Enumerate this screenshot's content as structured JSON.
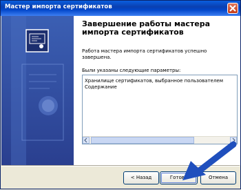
{
  "window": {
    "title": "Мастер импорта сертификатов"
  },
  "main": {
    "heading": "Завершение работы мастера импорта сертификатов",
    "description": "Работа мастера импорта сертификатов успешно завершена.",
    "params_label": "Были указаны следующие параметры:",
    "params": [
      "Хранилище сертификатов, выбранное пользователем",
      "Содержание"
    ]
  },
  "buttons": {
    "back": "< Назад",
    "finish": "Готово",
    "cancel": "Отмена"
  },
  "colors": {
    "titlebar": "#0a3fb0",
    "side_panel": "#2a3f8f",
    "arrow": "#1f4fbd"
  }
}
